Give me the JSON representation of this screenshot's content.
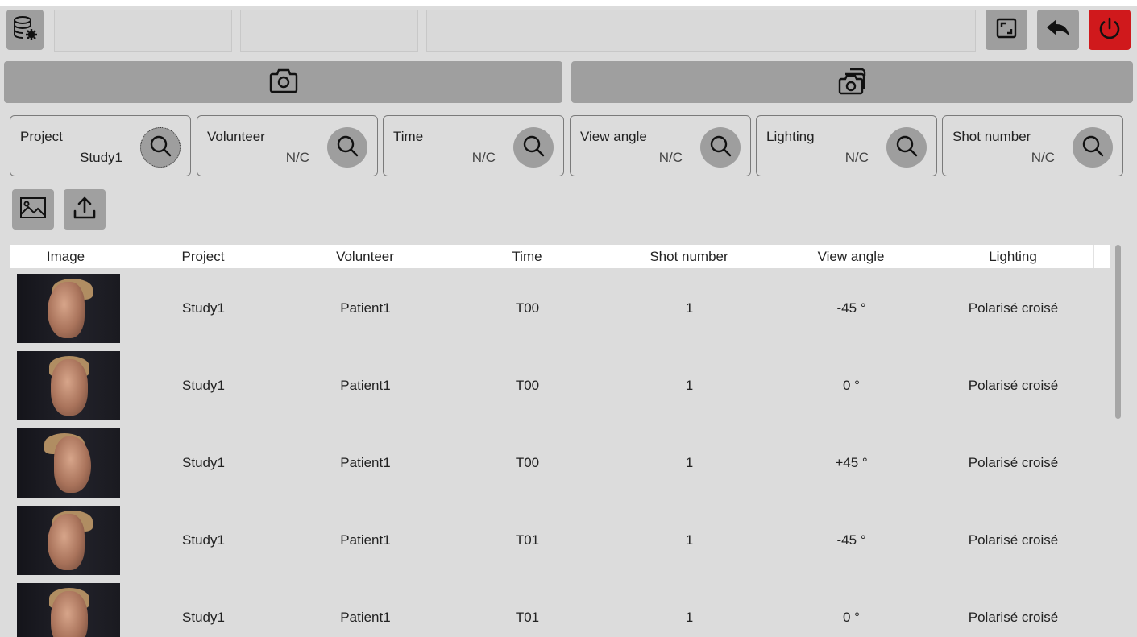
{
  "colors": {
    "power": "#d0191c",
    "button": "#9e9e9e",
    "background": "#dcdcdc"
  },
  "toolbar": {
    "left_icon": "database-settings-icon",
    "right_icons": [
      "fullscreen-icon",
      "back-arrow-icon",
      "power-icon"
    ],
    "fields": [
      "",
      "",
      ""
    ]
  },
  "capture": {
    "single_icon": "camera-icon",
    "multi_icon": "multi-camera-icon"
  },
  "filters": [
    {
      "label": "Project",
      "value": "Study1"
    },
    {
      "label": "Volunteer",
      "value": "N/C"
    },
    {
      "label": "Time",
      "value": "N/C"
    },
    {
      "label": "View angle",
      "value": "N/C"
    },
    {
      "label": "Lighting",
      "value": "N/C"
    },
    {
      "label": "Shot number",
      "value": "N/C"
    }
  ],
  "actions": {
    "image_icon": "image-icon",
    "upload_icon": "upload-icon"
  },
  "table": {
    "columns": [
      "Image",
      "Project",
      "Volunteer",
      "Time",
      "Shot number",
      "View angle",
      "Lighting"
    ],
    "rows": [
      {
        "project": "Study1",
        "volunteer": "Patient1",
        "time": "T00",
        "shot": "1",
        "angle": "-45 °",
        "lighting": "Polarisé croisé"
      },
      {
        "project": "Study1",
        "volunteer": "Patient1",
        "time": "T00",
        "shot": "1",
        "angle": "0 °",
        "lighting": "Polarisé croisé"
      },
      {
        "project": "Study1",
        "volunteer": "Patient1",
        "time": "T00",
        "shot": "1",
        "angle": "+45 °",
        "lighting": "Polarisé croisé"
      },
      {
        "project": "Study1",
        "volunteer": "Patient1",
        "time": "T01",
        "shot": "1",
        "angle": "-45 °",
        "lighting": "Polarisé croisé"
      },
      {
        "project": "Study1",
        "volunteer": "Patient1",
        "time": "T01",
        "shot": "1",
        "angle": "0 °",
        "lighting": "Polarisé croisé"
      }
    ]
  }
}
